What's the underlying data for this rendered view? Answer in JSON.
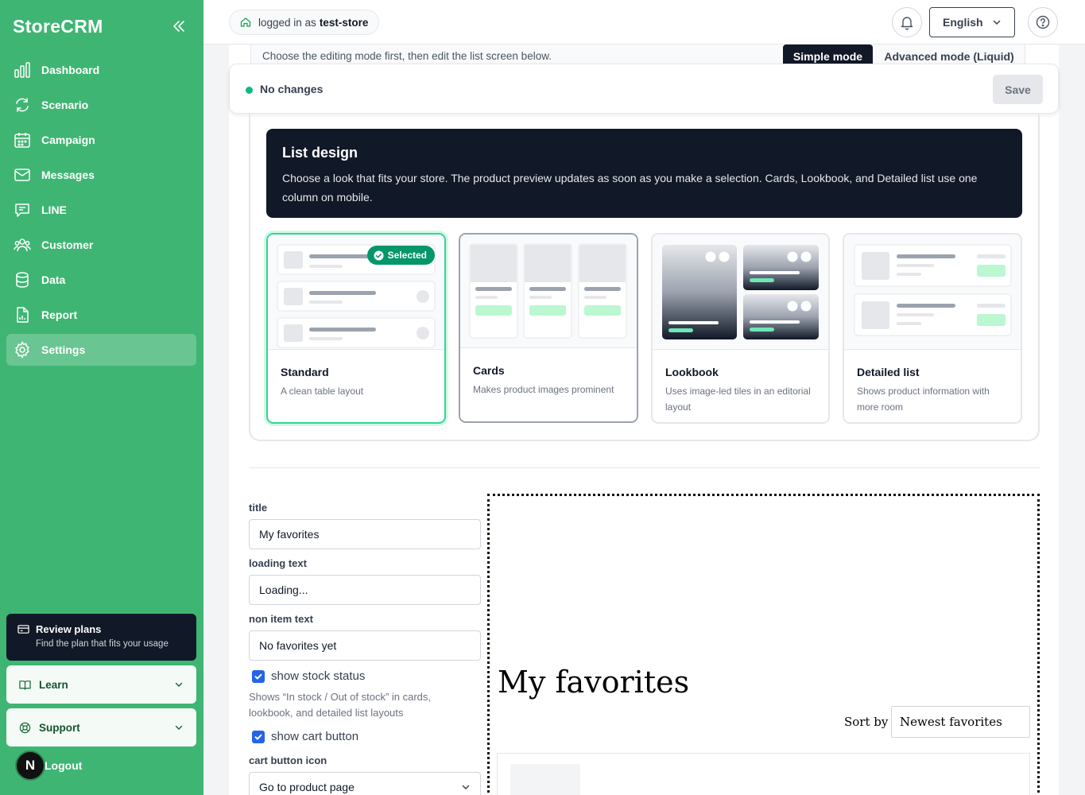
{
  "app": {
    "name": "StoreCRM"
  },
  "sidebar": {
    "items": [
      {
        "label": "Dashboard",
        "icon": "bar-chart-icon"
      },
      {
        "label": "Scenario",
        "icon": "refresh-icon"
      },
      {
        "label": "Campaign",
        "icon": "calendar-icon"
      },
      {
        "label": "Messages",
        "icon": "mail-icon"
      },
      {
        "label": "LINE",
        "icon": "chat-icon"
      },
      {
        "label": "Customer",
        "icon": "users-icon"
      },
      {
        "label": "Data",
        "icon": "database-icon"
      },
      {
        "label": "Report",
        "icon": "report-icon"
      },
      {
        "label": "Settings",
        "icon": "gear-icon",
        "active": true
      }
    ],
    "plans": {
      "title": "Review plans",
      "subtitle": "Find the plan that fits your usage"
    },
    "learn_label": "Learn",
    "support_label": "Support",
    "logout_label": "Logout",
    "avatar_letter": "N"
  },
  "header": {
    "login_prefix": "logged in as",
    "store_name": "test-store",
    "language": "English"
  },
  "editor": {
    "mode_hint": "Choose the editing mode first, then edit the list screen below.",
    "mode_simple": "Simple mode",
    "mode_advanced": "Advanced mode (Liquid)",
    "status": "No changes",
    "save_label": "Save"
  },
  "design": {
    "title": "List design",
    "description": "Choose a look that fits your store. The product preview updates as soon as you make a selection. Cards, Lookbook, and Detailed list use one column on mobile.",
    "selected_badge": "Selected",
    "options": [
      {
        "name": "Standard",
        "desc": "A clean table layout"
      },
      {
        "name": "Cards",
        "desc": "Makes product images prominent"
      },
      {
        "name": "Lookbook",
        "desc": "Uses image-led tiles in an editorial layout"
      },
      {
        "name": "Detailed list",
        "desc": "Shows product information with more room"
      }
    ]
  },
  "form": {
    "title_label": "title",
    "title_value": "My favorites",
    "loading_label": "loading text",
    "loading_value": "Loading...",
    "nonitem_label": "non item text",
    "nonitem_value": "No favorites yet",
    "stock_label": "show stock status",
    "stock_checked": true,
    "stock_help": "Shows “In stock / Out of stock” in cards, lookbook, and detailed list layouts",
    "cart_label": "show cart button",
    "cart_checked": true,
    "cart_icon_label": "cart button icon",
    "cart_icon_value": "Go to product page"
  },
  "preview": {
    "title": "My favorites",
    "sort_label": "Sort by",
    "sort_value": "Newest favorites"
  },
  "colors": {
    "sidebar": "#3fb573",
    "dark": "#111827",
    "selected_border": "#34d399",
    "badge": "#059669",
    "checkbox": "#2563eb"
  }
}
